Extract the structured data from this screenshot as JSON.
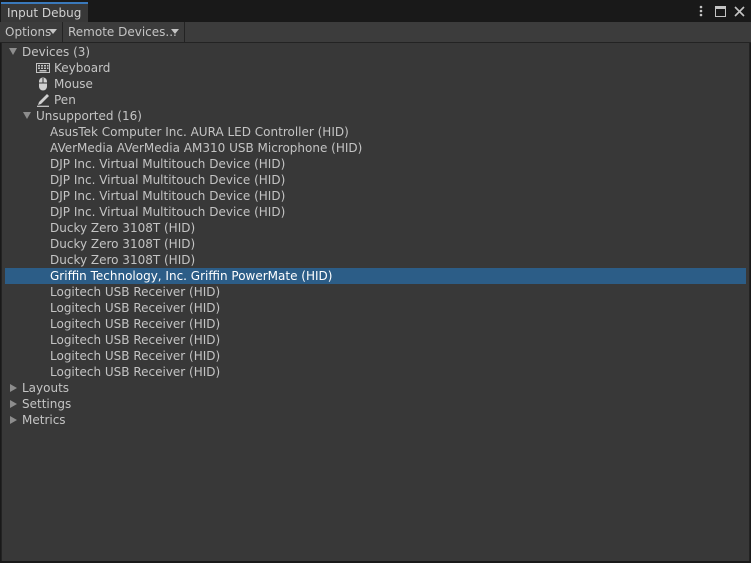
{
  "window": {
    "tab_title": "Input Debug",
    "controls": [
      {
        "name": "more-options-icon",
        "glyph": "⋮"
      },
      {
        "name": "maximize-icon",
        "glyph": "□"
      },
      {
        "name": "close-icon",
        "glyph": "✕"
      }
    ]
  },
  "toolbar": {
    "options_label": "Options",
    "remote_devices_label": "Remote Devices..."
  },
  "tree": {
    "devices": {
      "label": "Devices (3)",
      "items": [
        {
          "label": "Keyboard",
          "icon": "keyboard-icon"
        },
        {
          "label": "Mouse",
          "icon": "mouse-icon"
        },
        {
          "label": "Pen",
          "icon": "pen-icon"
        }
      ],
      "unsupported": {
        "label": "Unsupported (16)",
        "items": [
          "AsusTek Computer Inc. AURA LED Controller (HID)",
          "AVerMedia AVerMedia AM310 USB Microphone (HID)",
          "DJP Inc. Virtual Multitouch Device (HID)",
          "DJP Inc. Virtual Multitouch Device (HID)",
          "DJP Inc. Virtual Multitouch Device (HID)",
          "DJP Inc. Virtual Multitouch Device (HID)",
          "Ducky Zero 3108T (HID)",
          "Ducky Zero 3108T (HID)",
          "Ducky Zero 3108T (HID)",
          "Griffin Technology, Inc. Griffin PowerMate (HID)",
          "Logitech USB Receiver (HID)",
          "Logitech USB Receiver (HID)",
          "Logitech USB Receiver (HID)",
          "Logitech USB Receiver (HID)",
          "Logitech USB Receiver (HID)",
          "Logitech USB Receiver (HID)"
        ],
        "selected_index": 9
      }
    },
    "layouts_label": "Layouts",
    "settings_label": "Settings",
    "metrics_label": "Metrics"
  },
  "colors": {
    "selection": "#2c5d87",
    "panel": "#383838",
    "accent": "#3a79bb"
  }
}
